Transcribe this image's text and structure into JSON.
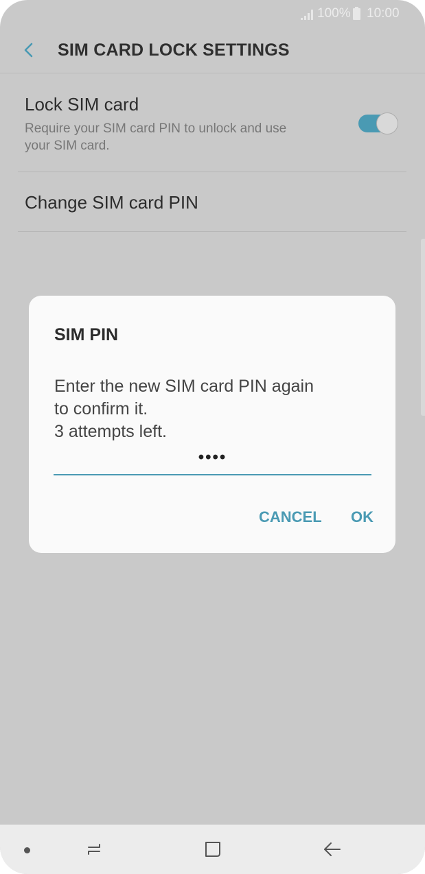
{
  "status_bar": {
    "battery_percent": "100%",
    "time": "10:00"
  },
  "header": {
    "title": "SIM CARD LOCK SETTINGS",
    "back_icon": "chevron-left-icon"
  },
  "settings": {
    "lock_sim": {
      "title": "Lock SIM card",
      "description": "Require your SIM card PIN to unlock and use your SIM card.",
      "enabled": true
    },
    "change_pin": {
      "title": "Change SIM card PIN"
    }
  },
  "dialog": {
    "title": "SIM PIN",
    "message_lines": [
      "Enter the new SIM card PIN again",
      "to confirm it.",
      "3 attempts left."
    ],
    "pin_value": "••••",
    "cancel_label": "CANCEL",
    "ok_label": "OK"
  },
  "nav_bar": {
    "icons": [
      "dot-icon",
      "recents-icon",
      "home-icon",
      "back-arrow-icon"
    ]
  },
  "colors": {
    "accent": "#4a9ab3",
    "background_dimmed": "#c9c9c9",
    "dialog_bg": "#fafafa",
    "nav_bg": "#ececec"
  }
}
